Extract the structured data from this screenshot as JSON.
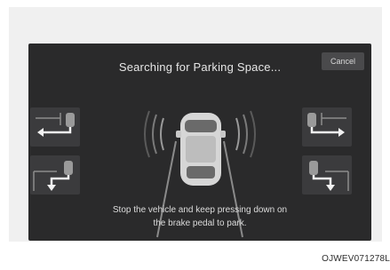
{
  "screen": {
    "title": "Searching for Parking Space...",
    "cancel_label": "Cancel",
    "message_line1": "Stop the vehicle and keep pressing down on",
    "message_line2": "the brake pedal to park."
  },
  "parking_modes": [
    {
      "icon": "parallel-left-icon"
    },
    {
      "icon": "perpendicular-left-icon"
    },
    {
      "icon": "parallel-right-icon"
    },
    {
      "icon": "perpendicular-right-icon"
    }
  ],
  "image_code": "OJWEV071278L"
}
